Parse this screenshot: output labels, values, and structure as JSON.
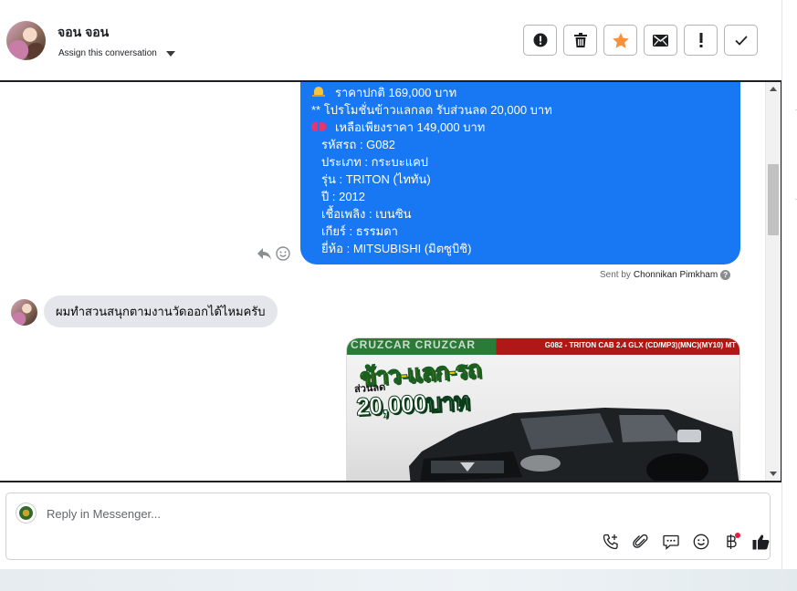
{
  "header": {
    "contact_name": "จอน จอน",
    "assign_label": "Assign this conversation",
    "actions": [
      {
        "name": "mark-spam-button",
        "icon": "alert-circle-icon"
      },
      {
        "name": "delete-button",
        "icon": "trash-icon"
      },
      {
        "name": "star-button",
        "icon": "star-icon"
      },
      {
        "name": "mark-unread-button",
        "icon": "envelope-icon"
      },
      {
        "name": "mark-important-button",
        "icon": "exclamation-icon"
      },
      {
        "name": "mark-done-button",
        "icon": "check-icon"
      }
    ],
    "star_color": "#f7923b"
  },
  "messages": {
    "outgoing": {
      "lines": [
        "ราคาปกติ 169,000 บาท",
        "** โปรโมชั่นข้าวแลกลด รับส่วนลด 20,000 บาท",
        "เหลือเพียงราคา 149,000 บาท",
        "รหัสรถ : G082",
        "ประเภท : กระบะแคป",
        "รุ่น : TRITON (ไททัน)",
        "ปี : 2012",
        "เชื้อเพลิง : เบนซิน",
        "เกียร์ : ธรรมดา",
        "ยี่ห้อ : MITSUBISHI (มิตซูบิชิ)"
      ],
      "bubble_color": "#1877f2"
    },
    "sent_by_prefix": "Sent by",
    "sent_by_name": "Chonnikan Pimkham",
    "help_mark": "?",
    "incoming_text": "ผมทำสวนสนุกตามงานวัดออกได้ไหมครับ",
    "image": {
      "brand_text": "CRUZCAR CRUZCAR",
      "model_text": "G082 - TRITON CAB 2.4 GLX (CD/MP3)(MNC)(MY10) MT",
      "promo_line1": "ข้าว-แลก-รถ",
      "promo_line2": "ส่วนลด",
      "promo_line3": "20,000บาท"
    }
  },
  "reply": {
    "placeholder": "Reply in Messenger..."
  }
}
